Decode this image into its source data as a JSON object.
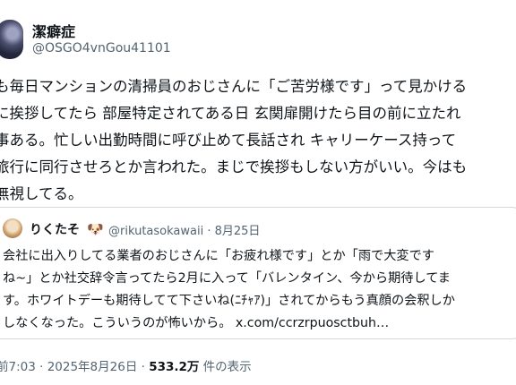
{
  "author": {
    "name": "潔癖症",
    "handle": "@OSGO4vnGou41101"
  },
  "post": {
    "lines": [
      "も毎日マンションの清掃員のおじさんに「ご苦労様です」って見かける",
      "に挨拶してたら 部屋特定されてある日 玄関扉開けたら目の前に立たれ",
      "事ある。忙しい出勤時間に呼び止めて長話され キャリーケース持って",
      "旅行に同行させろとか言われた。まじで挨拶もしない方がいい。今はも",
      "無視してる。"
    ]
  },
  "quote": {
    "name": "りくたそ",
    "emoji": "🐶",
    "handle_date": "@rikutasokawaii · 8月25日",
    "lines": [
      "会社に出入りしてる業者のおじさんに「お疲れ様です」とか「雨で大変です",
      "ね~」とか社交辞令言ってたら2月に入って「バレンタイン、今から期待してま",
      "す。ホワイトデーも期待してて下さいね(ﾆﾁｬｱ)」されてからもう真顔の会釈しか",
      "しなくなった。こういうのが怖いから。"
    ],
    "link": "x.com/ccrzrpuosctbuh…"
  },
  "meta": {
    "time_date": "前7:03 · 2025年8月26日 · ",
    "views": "533.2万",
    "views_label": " 件の表示"
  }
}
